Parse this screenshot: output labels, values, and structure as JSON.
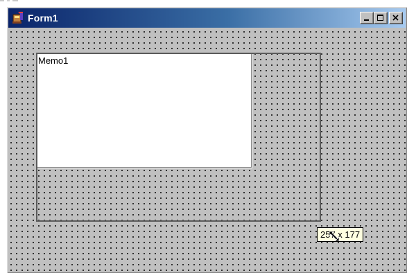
{
  "window": {
    "title": "Form1",
    "title_gradient_start": "#0a246a",
    "title_gradient_end": "#a6caf0",
    "client_color": "#c0c0c0"
  },
  "title_buttons": {
    "minimize_icon": "minimize-icon",
    "maximize_icon": "maximize-icon",
    "close_icon": "close-icon"
  },
  "memo": {
    "text": "Memo1",
    "background": "#ffffff"
  },
  "size_hint": {
    "text": "257 x 177",
    "background": "#ffffe1"
  },
  "cursor": {
    "icon": "resize-diagonal-cursor-icon"
  }
}
